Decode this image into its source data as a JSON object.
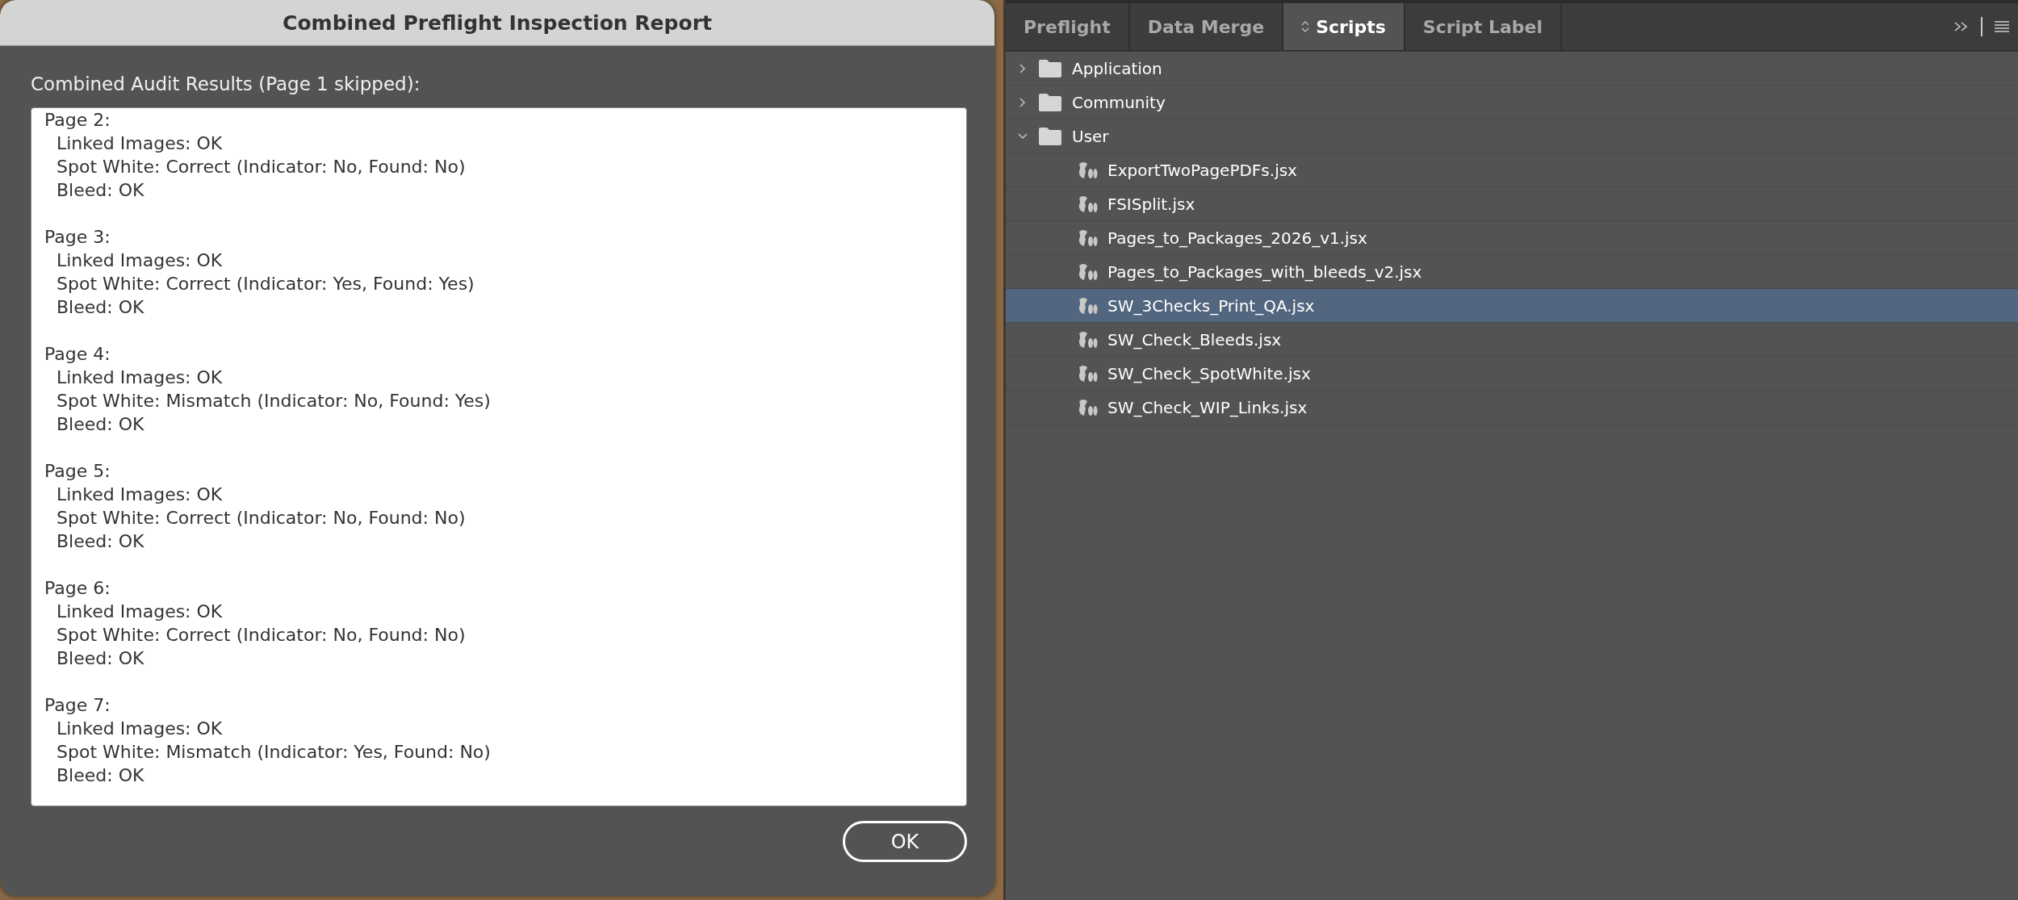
{
  "dialog": {
    "title": "Combined Preflight Inspection Report",
    "heading": "Combined Audit Results (Page 1 skipped):",
    "report": [
      {
        "page": "Page 2:",
        "lines": [
          "Linked Images: OK",
          "Spot White: Correct (Indicator: No, Found: No)",
          "Bleed: OK"
        ]
      },
      {
        "page": "Page 3:",
        "lines": [
          "Linked Images: OK",
          "Spot White: Correct (Indicator: Yes, Found: Yes)",
          "Bleed: OK"
        ]
      },
      {
        "page": "Page 4:",
        "lines": [
          "Linked Images: OK",
          "Spot White: Mismatch (Indicator: No, Found: Yes)",
          "Bleed: OK"
        ]
      },
      {
        "page": "Page 5:",
        "lines": [
          "Linked Images: OK",
          "Spot White: Correct (Indicator: No, Found: No)",
          "Bleed: OK"
        ]
      },
      {
        "page": "Page 6:",
        "lines": [
          "Linked Images: OK",
          "Spot White: Correct (Indicator: No, Found: No)",
          "Bleed: OK"
        ]
      },
      {
        "page": "Page 7:",
        "lines": [
          "Linked Images: OK",
          "Spot White: Mismatch (Indicator: Yes, Found: No)",
          "Bleed: OK"
        ]
      }
    ],
    "ok_button": "OK"
  },
  "panel": {
    "tabs": [
      {
        "label": "Preflight",
        "selected": false
      },
      {
        "label": "Data Merge",
        "selected": false
      },
      {
        "label": "Scripts",
        "selected": true
      },
      {
        "label": "Script Label",
        "selected": false
      }
    ],
    "tree": [
      {
        "label": "Application",
        "expanded": false
      },
      {
        "label": "Community",
        "expanded": false
      },
      {
        "label": "User",
        "expanded": true,
        "children": [
          {
            "label": "ExportTwoPagePDFs.jsx",
            "selected": false
          },
          {
            "label": "FSISplit.jsx",
            "selected": false
          },
          {
            "label": "Pages_to_Packages_2026_v1.jsx",
            "selected": false
          },
          {
            "label": "Pages_to_Packages_with_bleeds_v2.jsx",
            "selected": false
          },
          {
            "label": "SW_3Checks_Print_QA.jsx",
            "selected": true
          },
          {
            "label": "SW_Check_Bleeds.jsx",
            "selected": false
          },
          {
            "label": "SW_Check_SpotWhite.jsx",
            "selected": false
          },
          {
            "label": "SW_Check_WIP_Links.jsx",
            "selected": false
          }
        ]
      }
    ]
  }
}
